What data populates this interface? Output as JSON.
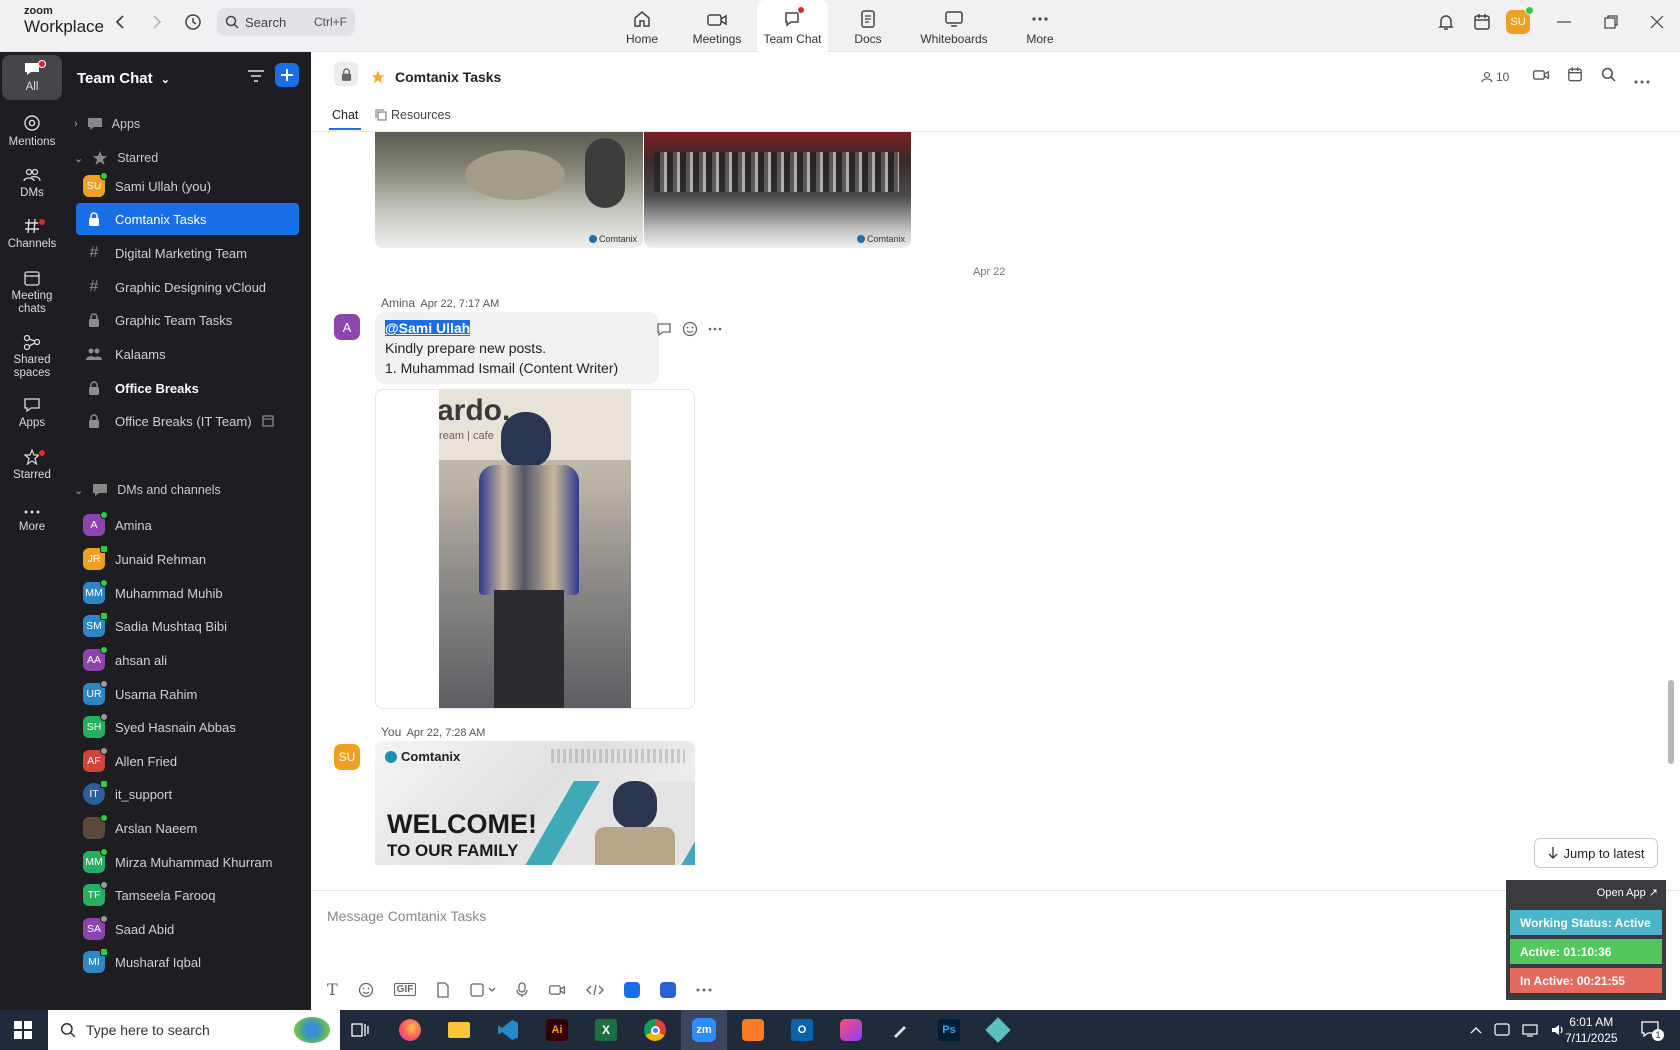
{
  "app": {
    "brand_small": "zoom",
    "brand_large": "Workplace"
  },
  "search": {
    "placeholder": "Search",
    "shortcut": "Ctrl+F"
  },
  "nav_tabs": [
    {
      "label": "Home"
    },
    {
      "label": "Meetings"
    },
    {
      "label": "Team Chat"
    },
    {
      "label": "Docs"
    },
    {
      "label": "Whiteboards"
    },
    {
      "label": "More"
    }
  ],
  "user_avatar": "SU",
  "rail": [
    {
      "label": "All"
    },
    {
      "label": "Mentions"
    },
    {
      "label": "DMs"
    },
    {
      "label": "Channels"
    },
    {
      "label": "Meeting chats"
    },
    {
      "label": "Shared spaces"
    },
    {
      "label": "Apps"
    },
    {
      "label": "Starred"
    },
    {
      "label": "More"
    }
  ],
  "sidebar": {
    "title": "Team Chat",
    "apps_label": "Apps",
    "starred_label": "Starred",
    "dms_label": "DMs and channels",
    "starred_items": [
      {
        "label": "Sami Ullah (you)",
        "initials": "SU",
        "color": "#f0a020",
        "kind": "avatar"
      },
      {
        "label": "Comtanix Tasks",
        "kind": "lock"
      },
      {
        "label": "Digital Marketing Team",
        "kind": "hash"
      },
      {
        "label": "Graphic Designing vCloud",
        "kind": "hash"
      },
      {
        "label": "Graphic Team Tasks",
        "kind": "lock"
      },
      {
        "label": "Kalaams",
        "kind": "people"
      },
      {
        "label": "Office Breaks",
        "kind": "lock"
      },
      {
        "label": "Office Breaks (IT Team)",
        "kind": "lock"
      }
    ],
    "dm_items": [
      {
        "label": "Amina",
        "initials": "A",
        "color": "#8e44ad"
      },
      {
        "label": "Junaid Rehman",
        "initials": "JR",
        "color": "#f0a020"
      },
      {
        "label": "Muhammad Muhib",
        "initials": "MM",
        "color": "#2f86c4"
      },
      {
        "label": "Sadia Mushtaq Bibi",
        "initials": "SM",
        "color": "#2f86c4"
      },
      {
        "label": "ahsan ali",
        "initials": "AA",
        "color": "#8e44ad"
      },
      {
        "label": "Usama Rahim",
        "initials": "UR",
        "color": "#2f86c4"
      },
      {
        "label": "Syed Hasnain Abbas",
        "initials": "SH",
        "color": "#27ae60"
      },
      {
        "label": "Allen Fried",
        "initials": "AF",
        "color": "#d0453a"
      },
      {
        "label": "it_support",
        "initials": "IT",
        "color": "#2f5f9a"
      },
      {
        "label": "Arslan Naeem",
        "initials": "",
        "color": "#5a4a3a"
      },
      {
        "label": "Mirza Muhammad Khurram",
        "initials": "MM",
        "color": "#27ae60"
      },
      {
        "label": "Tamseela Farooq",
        "initials": "TF",
        "color": "#27ae60"
      },
      {
        "label": "Saad Abid",
        "initials": "SA",
        "color": "#8e44ad"
      },
      {
        "label": "Musharaf Iqbal",
        "initials": "MI",
        "color": "#2f86c4"
      }
    ]
  },
  "channel": {
    "title": "Comtanix Tasks",
    "member_count": "10",
    "tabs": [
      {
        "label": "Chat"
      },
      {
        "label": "Resources"
      }
    ],
    "photo_watermark": "Comtanix",
    "date_separator": "Apr 22",
    "messages": [
      {
        "author": "Amina",
        "time": "Apr 22, 7:17 AM",
        "avatar": "A",
        "mention": "@Sami Ullah",
        "lines": [
          "Kindly prepare new posts.",
          "1. Muhammad Ismail (Content Writer)"
        ],
        "photo_text": "ardo.",
        "photo_subtext": "ream | cafe"
      },
      {
        "author": "You",
        "time": "Apr 22, 7:28 AM",
        "avatar": "SU",
        "card_brand": "Comtanix",
        "card_line1": "WELCOME!",
        "card_line2": "TO OUR FAMILY"
      }
    ],
    "composer_placeholder": "Message Comtanix Tasks",
    "jump_label": "Jump to latest"
  },
  "widget": {
    "open_app": "Open App ↗",
    "status": "Working Status: Active",
    "active": "Active: 01:10:36",
    "inactive": "In Active: 00:21:55"
  },
  "taskbar": {
    "search_placeholder": "Type here to search",
    "time": "6:01 AM",
    "date": "7/11/2025",
    "notif_count": "1"
  }
}
